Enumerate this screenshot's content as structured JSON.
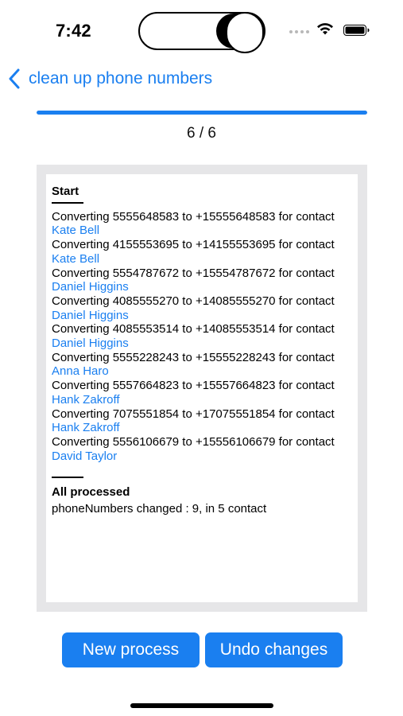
{
  "status_bar": {
    "time": "7:42"
  },
  "nav": {
    "back_title": "clean up phone numbers"
  },
  "progress": {
    "label": "6 / 6",
    "fraction": 1.0
  },
  "log": {
    "start_heading": "Start",
    "entries": [
      {
        "text": "Converting 5555648583 to +15555648583 for contact",
        "contact": "Kate Bell"
      },
      {
        "text": "Converting 4155553695 to +14155553695 for contact",
        "contact": "Kate Bell"
      },
      {
        "text": "Converting 5554787672 to +15554787672 for contact",
        "contact": "Daniel Higgins"
      },
      {
        "text": "Converting 4085555270 to +14085555270 for contact",
        "contact": "Daniel Higgins"
      },
      {
        "text": "Converting 4085553514 to +14085553514 for contact",
        "contact": "Daniel Higgins"
      },
      {
        "text": "Converting 5555228243 to +15555228243 for contact",
        "contact": "Anna Haro"
      },
      {
        "text": "Converting 5557664823 to +15557664823 for contact",
        "contact": "Hank Zakroff"
      },
      {
        "text": "Converting 7075551854 to +17075551854 for contact",
        "contact": "Hank Zakroff"
      },
      {
        "text": "Converting 5556106679 to +15556106679 for contact",
        "contact": "David Taylor"
      }
    ],
    "end_heading": "All processed",
    "summary": "phoneNumbers changed : 9, in 5 contact"
  },
  "buttons": {
    "new_process": "New process",
    "undo_changes": "Undo changes"
  },
  "colors": {
    "accent": "#1a7ff0",
    "panel_bg": "#e6e6e8"
  },
  "icons": {
    "back": "chevron-left-icon",
    "wifi": "wifi-icon",
    "battery": "battery-icon"
  }
}
